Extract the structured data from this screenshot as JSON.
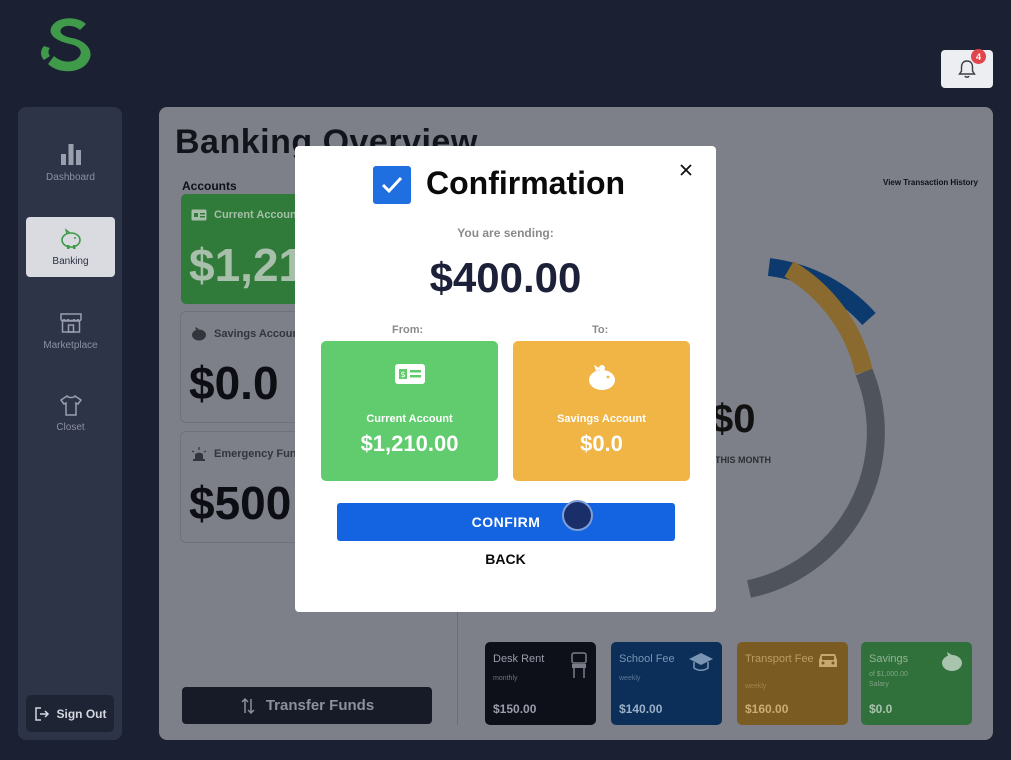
{
  "notifications": {
    "count": "4",
    "icon": "bell-icon"
  },
  "sidebar": {
    "items": [
      {
        "label": "Dashboard",
        "icon": "bar-chart-icon",
        "active": false
      },
      {
        "label": "Banking",
        "icon": "piggy-bank-icon",
        "active": true
      },
      {
        "label": "Marketplace",
        "icon": "store-icon",
        "active": false
      },
      {
        "label": "Closet",
        "icon": "shirt-icon",
        "active": false
      }
    ],
    "signout_label": "Sign Out"
  },
  "main": {
    "title": "Banking Overview",
    "accounts_heading": "Accounts",
    "view_history_label": "View Transaction History",
    "accounts": [
      {
        "name": "Current Account",
        "amount": "$1,210.00",
        "color": "#60cc6e"
      },
      {
        "name": "Savings Account",
        "amount": "$0.0",
        "color": "#f2f2f2"
      },
      {
        "name": "Emergency Fund",
        "amount": "$500",
        "color": "#f2f2f2"
      }
    ],
    "transfer_label": "Transfer Funds",
    "donut": {
      "value": "$0",
      "sub": "THIS MONTH"
    },
    "bills": [
      {
        "name": "Desk Rent",
        "freq": "monthly",
        "amount": "$150.00",
        "color": "#1c2235",
        "icon": "desk-icon"
      },
      {
        "name": "School Fee",
        "freq": "weekly",
        "amount": "$140.00",
        "color": "#1a64b8",
        "icon": "graduation-cap-icon"
      },
      {
        "name": "Transport Fee",
        "freq": "weekly",
        "amount": "$160.00",
        "color": "#f0b545",
        "icon": "car-icon"
      },
      {
        "name": "Savings",
        "freq": "of $1,000.00 Salary",
        "amount": "$0.0",
        "color": "#60cc6e",
        "icon": "piggy-bank-icon"
      }
    ]
  },
  "modal": {
    "title": "Confirmation",
    "sending_label": "You are sending:",
    "amount": "$400.00",
    "from_label": "From:",
    "to_label": "To:",
    "from": {
      "name": "Current Account",
      "amount": "$1,210.00",
      "icon": "card-icon",
      "color": "#60cc6e"
    },
    "to": {
      "name": "Savings Account",
      "amount": "$0.0",
      "icon": "piggy-bank-icon",
      "color": "#f0b545"
    },
    "confirm_label": "CONFIRM",
    "back_label": "BACK"
  },
  "colors": {
    "accent": "#1463e0",
    "green": "#60cc6e",
    "yellow": "#f0b545",
    "navy": "#1b2033"
  }
}
